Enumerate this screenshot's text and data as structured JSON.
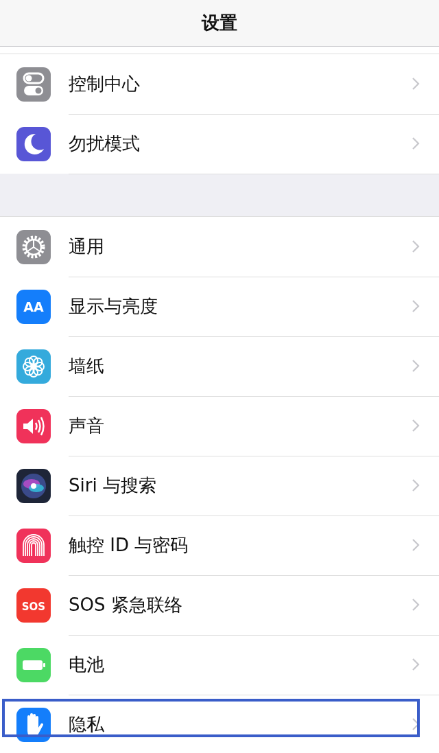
{
  "header": {
    "title": "设置"
  },
  "sections": [
    {
      "rows": [
        {
          "label": "控制中心",
          "kind": "toggles",
          "color": "#8e8e93",
          "selected": false
        },
        {
          "label": "勿扰模式",
          "kind": "moon",
          "color": "#5856d6",
          "selected": false
        }
      ]
    },
    {
      "rows": [
        {
          "label": "通用",
          "kind": "gear",
          "color": "#8e8e93",
          "selected": false
        },
        {
          "label": "显示与亮度",
          "kind": "text",
          "icon_label": "AA",
          "color": "#147efb",
          "selected": false
        },
        {
          "label": "墙纸",
          "kind": "flower",
          "color": "#34aadc",
          "selected": false
        },
        {
          "label": "声音",
          "kind": "speaker",
          "color": "#f0325a",
          "selected": false
        },
        {
          "label": "Siri 与搜索",
          "kind": "siri",
          "color": "#1e2538",
          "selected": false
        },
        {
          "label": "触控 ID 与密码",
          "kind": "fingerprint",
          "color": "#f0325a",
          "selected": false
        },
        {
          "label": "SOS 紧急联络",
          "kind": "text",
          "icon_label": "SOS",
          "color": "#f2382f",
          "selected": false
        },
        {
          "label": "电池",
          "kind": "battery",
          "color": "#4cd964",
          "selected": false
        },
        {
          "label": "隐私",
          "kind": "hand",
          "color": "#147efb",
          "selected": true
        }
      ]
    }
  ]
}
